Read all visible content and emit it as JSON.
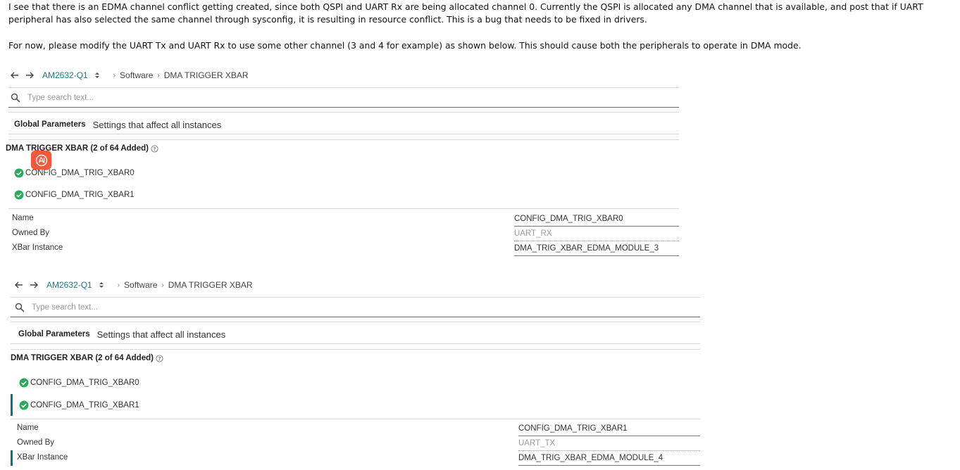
{
  "paragraphs": {
    "p1": "I see that there is an EDMA channel conflict getting created, since both QSPI and UART Rx are being allocated channel 0. Currently the QSPI is allocated any DMA channel that is available, and post that if UART peripheral has also selected the same channel through sysconfig, it is resulting in resource conflict. This is a bug that needs to be fixed in drivers.",
    "p2": "For now, please modify the UART Tx and UART Rx to use some other channel (3 and 4 for example) as shown below. This should cause both the peripherals to operate in DMA mode."
  },
  "panel1": {
    "nav": {
      "device": "AM2632-Q1",
      "crumbs": [
        "Software",
        "DMA TRIGGER XBAR"
      ]
    },
    "search": {
      "placeholder": "Type search text..."
    },
    "global": {
      "title": "Global Parameters",
      "description": "Settings that affect all instances"
    },
    "module_title": "DMA TRIGGER XBAR (2 of 64 Added)",
    "instances": [
      "CONFIG_DMA_TRIG_XBAR0",
      "CONFIG_DMA_TRIG_XBAR1"
    ],
    "properties": {
      "name_label": "Name",
      "name_value": "CONFIG_DMA_TRIG_XBAR0",
      "owned_label": "Owned By",
      "owned_value": "UART_RX",
      "xbar_label": "XBar Instance",
      "xbar_value": "DMA_TRIG_XBAR_EDMA_MODULE_3"
    }
  },
  "panel2": {
    "nav": {
      "device": "AM2632-Q1",
      "crumbs": [
        "Software",
        "DMA TRIGGER XBAR"
      ]
    },
    "search": {
      "placeholder": "Type search text..."
    },
    "global": {
      "title": "Global Parameters",
      "description": "Settings that affect all instances"
    },
    "module_title": "DMA TRIGGER XBAR (2 of 64 Added)",
    "instances": [
      "CONFIG_DMA_TRIG_XBAR0",
      "CONFIG_DMA_TRIG_XBAR1"
    ],
    "properties": {
      "name_label": "Name",
      "name_value": "CONFIG_DMA_TRIG_XBAR1",
      "owned_label": "Owned By",
      "owned_value": "UART_TX",
      "xbar_label": "XBar Instance",
      "xbar_value": "DMA_TRIG_XBAR_EDMA_MODULE_4"
    }
  },
  "icons": {
    "back": "arrow-left-icon",
    "forward": "arrow-right-icon",
    "device_switch": "sort-updown-icon",
    "search": "search-icon",
    "help": "help-circle-icon",
    "instance_ok": "check-circle-icon",
    "ai": "ai-assistant-icon"
  },
  "colors": {
    "accent": "#1f7a86",
    "selection_bar": "#1b6f7a",
    "ok_green": "#2eaa5c",
    "ai_badge": "#ef5a3c"
  }
}
